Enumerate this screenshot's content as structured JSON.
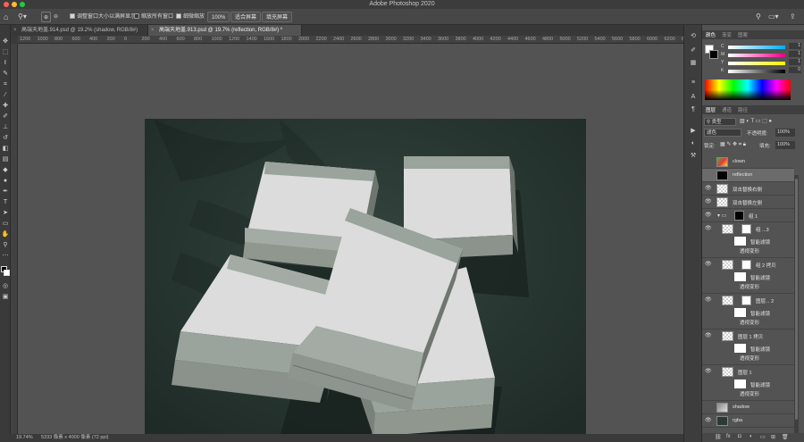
{
  "app_title": "Adobe Photoshop 2020",
  "options_bar": {
    "resize_windows_label": "调整窗口大小以满屏显示",
    "zoom_all_windows_label": "缩放所有窗口",
    "scrubby_zoom_label": "细微缩放",
    "zoom_level": "100%",
    "fit_screen_label": "适合屏幕",
    "fill_screen_label": "填充屏幕"
  },
  "tabs": [
    {
      "label": "高端天地盖.914.psd @ 19.2% (shadow, RGB/8#)",
      "active": false
    },
    {
      "label": "高端天地盖.913.psd @ 19.7% (reflection, RGB/8#) *",
      "active": true
    }
  ],
  "ruler_ticks": [
    "1200",
    "1000",
    "800",
    "600",
    "400",
    "200",
    "0",
    "200",
    "400",
    "600",
    "800",
    "1000",
    "1200",
    "1400",
    "1600",
    "1800",
    "2000",
    "2200",
    "2400",
    "2600",
    "2800",
    "3000",
    "3200",
    "3400",
    "3600",
    "3800",
    "4000",
    "4200",
    "4400",
    "4600",
    "4800",
    "5000",
    "5200",
    "5400",
    "5600",
    "5800",
    "6000",
    "6200",
    "6400"
  ],
  "status": {
    "zoom": "19.74%",
    "doc_info": "5333 像素 x 4000 像素 (72 ppi)"
  },
  "color_panel": {
    "tabs": [
      "颜色",
      "渐变",
      "图案"
    ],
    "channels": [
      {
        "label": "C",
        "value": "1"
      },
      {
        "label": "M",
        "value": "1"
      },
      {
        "label": "Y",
        "value": "1"
      },
      {
        "label": "K",
        "value": "0"
      }
    ]
  },
  "layers_panel": {
    "tabs": [
      "图层",
      "通道",
      "路径"
    ],
    "filter_kind": "类型",
    "blend_mode": "滤色",
    "opacity_label": "不透明度:",
    "opacity_value": "100%",
    "lock_label": "锁定:",
    "fill_label": "填充:",
    "fill_value": "100%",
    "layers": [
      {
        "name": "clown"
      },
      {
        "name": "reflection"
      },
      {
        "name": "双击替换右侧"
      },
      {
        "name": "双击替换左侧"
      },
      {
        "name": "组 1"
      },
      {
        "name": "组 ...3"
      },
      {
        "name": "组 2 拷贝"
      },
      {
        "name": "图层... 2"
      },
      {
        "name": "图层 1 拷贝"
      },
      {
        "name": "图层 1"
      },
      {
        "name": "shadow"
      },
      {
        "name": "rgba"
      }
    ],
    "smart_filters_label": "智能滤镜",
    "perspective_warp_label": "透视变形"
  },
  "colors": {
    "background_dark": "#2b3a35",
    "box_side": "#9aa39c",
    "box_top_white": "#dcdcdc"
  }
}
